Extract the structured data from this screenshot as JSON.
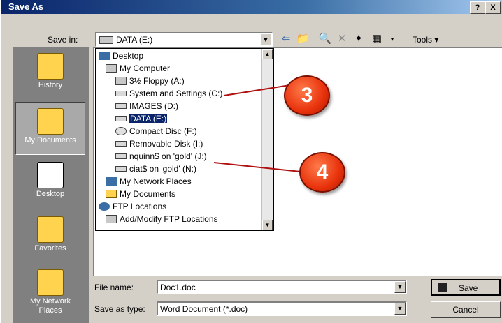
{
  "window": {
    "title": "Save As",
    "help_label": "?",
    "close_label": "X"
  },
  "toolbar": {
    "save_in_label": "Save in:",
    "save_in_value": "DATA (E:)",
    "tools_label": "Tools"
  },
  "places": [
    {
      "label": "History",
      "icon": "history-icon",
      "selected": false
    },
    {
      "label": "My Documents",
      "icon": "my-documents-icon",
      "selected": true
    },
    {
      "label": "Desktop",
      "icon": "desktop-icon",
      "selected": false
    },
    {
      "label": "Favorites",
      "icon": "favorites-icon",
      "selected": false
    },
    {
      "label": "My Network Places",
      "icon": "network-places-icon",
      "selected": false
    }
  ],
  "dropdown": {
    "items": [
      {
        "label": "Desktop",
        "icon": "desktop-icon",
        "indent": 0
      },
      {
        "label": "My Computer",
        "icon": "computer-icon",
        "indent": 1
      },
      {
        "label": "3½ Floppy (A:)",
        "icon": "floppy-icon",
        "indent": 2
      },
      {
        "label": "System and Settings (C:)",
        "icon": "drive-icon",
        "indent": 2
      },
      {
        "label": "IMAGES (D:)",
        "icon": "drive-icon",
        "indent": 2
      },
      {
        "label": "DATA (E:)",
        "icon": "drive-icon",
        "indent": 2,
        "selected": true
      },
      {
        "label": "Compact Disc (F:)",
        "icon": "cd-icon",
        "indent": 2
      },
      {
        "label": "Removable Disk (I:)",
        "icon": "drive-icon",
        "indent": 2
      },
      {
        "label": "nquinn$ on 'gold' (J:)",
        "icon": "network-drive-icon",
        "indent": 2
      },
      {
        "label": "ciat$ on 'gold' (N:)",
        "icon": "network-drive-icon",
        "indent": 2
      },
      {
        "label": "My Network Places",
        "icon": "network-places-icon",
        "indent": 1
      },
      {
        "label": "My Documents",
        "icon": "folder-icon",
        "indent": 1
      },
      {
        "label": "FTP Locations",
        "icon": "ftp-icon",
        "indent": 0
      },
      {
        "label": "Add/Modify FTP Locations",
        "icon": "ftp-add-icon",
        "indent": 1
      }
    ]
  },
  "file_name": {
    "label": "File name:",
    "value": "Doc1.doc"
  },
  "save_as_type": {
    "label": "Save as type:",
    "value": "Word Document (*.doc)"
  },
  "buttons": {
    "save": "Save",
    "cancel": "Cancel"
  },
  "callouts": [
    "3",
    "4"
  ],
  "colors": {
    "titlebar": "#0a246a",
    "selection": "#0a246a",
    "callout": "#e8320c"
  }
}
